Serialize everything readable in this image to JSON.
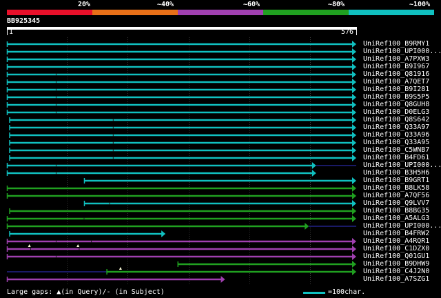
{
  "scale": {
    "labels": [
      "20%",
      "~40%",
      "~60%",
      "~80%",
      "~100%"
    ],
    "colors": [
      "#e8102a",
      "#e87018",
      "#a040b0",
      "#20a020",
      "#10c0c0"
    ]
  },
  "query": {
    "name": "BB925345",
    "start": "1",
    "end": "576"
  },
  "hits": [
    {
      "label": "UniRef100_B9RMY1",
      "color": "#10c0c0",
      "start": 1,
      "end": 576,
      "arrow": true,
      "gaps": [],
      "ticks": []
    },
    {
      "label": "UniRef100_UPI000...",
      "color": "#10c0c0",
      "start": 1,
      "end": 576,
      "arrow": true,
      "gaps": [],
      "ticks": []
    },
    {
      "label": "UniRef100_A7PXW3",
      "color": "#10c0c0",
      "start": 1,
      "end": 576,
      "arrow": true,
      "gaps": [],
      "ticks": []
    },
    {
      "label": "UniRef100_B9I967",
      "color": "#10c0c0",
      "start": 1,
      "end": 576,
      "arrow": true,
      "gaps": [],
      "ticks": []
    },
    {
      "label": "UniRef100_Q81916",
      "color": "#10c0c0",
      "start": 1,
      "end": 576,
      "arrow": true,
      "gaps": [],
      "ticks": [
        82
      ]
    },
    {
      "label": "UniRef100_A7QET7",
      "color": "#10c0c0",
      "start": 1,
      "end": 576,
      "arrow": true,
      "gaps": [],
      "ticks": [
        82
      ]
    },
    {
      "label": "UniRef100_B9I281",
      "color": "#10c0c0",
      "start": 1,
      "end": 576,
      "arrow": true,
      "gaps": [],
      "ticks": [
        82
      ]
    },
    {
      "label": "UniRef100_B9S5P5",
      "color": "#10c0c0",
      "start": 1,
      "end": 576,
      "arrow": true,
      "gaps": [],
      "ticks": [
        82
      ]
    },
    {
      "label": "UniRef100_Q8GUH8",
      "color": "#10c0c0",
      "start": 1,
      "end": 576,
      "arrow": true,
      "gaps": [],
      "ticks": [
        82
      ]
    },
    {
      "label": "UniRef100_D0ELG3",
      "color": "#10c0c0",
      "start": 1,
      "end": 576,
      "arrow": true,
      "gaps": [],
      "ticks": [
        82
      ]
    },
    {
      "label": "UniRef100_Q8S642",
      "color": "#10c0c0",
      "start": 5,
      "end": 576,
      "arrow": true,
      "gaps": [],
      "ticks": [
        176
      ]
    },
    {
      "label": "UniRef100_Q33A97",
      "color": "#10c0c0",
      "start": 5,
      "end": 576,
      "arrow": true,
      "gaps": [],
      "ticks": [
        176
      ]
    },
    {
      "label": "UniRef100_Q33A96",
      "color": "#10c0c0",
      "start": 5,
      "end": 576,
      "arrow": true,
      "gaps": [],
      "ticks": [
        176
      ]
    },
    {
      "label": "UniRef100_Q33A95",
      "color": "#10c0c0",
      "start": 5,
      "end": 576,
      "arrow": true,
      "gaps": [],
      "ticks": [
        176
      ]
    },
    {
      "label": "UniRef100_C5WNB7",
      "color": "#10c0c0",
      "start": 5,
      "end": 576,
      "arrow": true,
      "gaps": [],
      "ticks": [
        176
      ]
    },
    {
      "label": "UniRef100_B4FD61",
      "color": "#10c0c0",
      "start": 5,
      "end": 576,
      "arrow": true,
      "gaps": [],
      "ticks": [
        176
      ]
    },
    {
      "label": "UniRef100_UPI000...",
      "color": "#10c0c0",
      "start": 1,
      "end": 510,
      "arrow": true,
      "gaps": [
        [
          510,
          576
        ]
      ],
      "ticks": [
        82
      ]
    },
    {
      "label": "UniRef100_B3H5H6",
      "color": "#10c0c0",
      "start": 1,
      "end": 510,
      "arrow": true,
      "gaps": [],
      "ticks": [
        82
      ]
    },
    {
      "label": "UniRef100_B9GRT1",
      "color": "#10c0c0",
      "start": 128,
      "end": 576,
      "arrow": true,
      "gaps": [],
      "ticks": []
    },
    {
      "label": "UniRef100_B8LK58",
      "color": "#20a020",
      "start": 1,
      "end": 576,
      "arrow": true,
      "gaps": [],
      "ticks": []
    },
    {
      "label": "UniRef100_A7QF56",
      "color": "#20a020",
      "start": 1,
      "end": 576,
      "arrow": true,
      "gaps": [],
      "ticks": []
    },
    {
      "label": "UniRef100_Q9LVV7",
      "color": "#10c0c0",
      "start": 128,
      "end": 576,
      "arrow": true,
      "gaps": [],
      "ticks": [
        170
      ]
    },
    {
      "label": "UniRef100_B8BG35",
      "color": "#20a020",
      "start": 5,
      "end": 576,
      "arrow": true,
      "gaps": [
        [
          25,
          70
        ]
      ],
      "ticks": []
    },
    {
      "label": "UniRef100_A5ALG3",
      "color": "#20a020",
      "start": 1,
      "end": 576,
      "arrow": true,
      "gaps": [],
      "ticks": [
        128
      ]
    },
    {
      "label": "UniRef100_UPI000...",
      "color": "#20a020",
      "start": 1,
      "end": 498,
      "arrow": true,
      "gaps": [
        [
          498,
          576
        ]
      ],
      "ticks": []
    },
    {
      "label": "UniRef100_B4FRW2",
      "color": "#10c0c0",
      "start": 5,
      "end": 262,
      "arrow": true,
      "gaps": [],
      "ticks": []
    },
    {
      "label": "UniRef100_A4RQR1",
      "color": "#a040b0",
      "start": 1,
      "end": 576,
      "arrow": true,
      "gaps": [],
      "ticks": [
        82,
        140
      ]
    },
    {
      "label": "UniRef100_C1DZX0",
      "color": "#a040b0",
      "start": 1,
      "end": 576,
      "arrow": true,
      "gaps": [],
      "ticks": [
        40,
        120
      ]
    },
    {
      "label": "UniRef100_Q01GU1",
      "color": "#a040b0",
      "start": 1,
      "end": 576,
      "arrow": true,
      "gaps": [],
      "ticks": [
        82
      ]
    },
    {
      "label": "UniRef100_B9DHW9",
      "color": "#20a020",
      "start": 282,
      "end": 576,
      "arrow": true,
      "gaps": [],
      "ticks": []
    },
    {
      "label": "UniRef100_C4J2N0",
      "color": "#20a020",
      "start": 165,
      "end": 576,
      "arrow": true,
      "gaps": [
        [
          1,
          165
        ]
      ],
      "ticks": []
    },
    {
      "label": "UniRef100_A7SZG1",
      "color": "#a040b0",
      "start": 1,
      "end": 360,
      "arrow": true,
      "gaps": [],
      "ticks": []
    }
  ],
  "query_gap_marks": [
    {
      "row": 27,
      "pos": 38
    },
    {
      "row": 27,
      "pos": 118
    },
    {
      "row": 30,
      "pos": 188
    }
  ],
  "legend": {
    "text": "Large gaps: ▲(in Query)/- (in Subject)",
    "scale_text": "=100char.",
    "line_color": "#10c0c0"
  }
}
